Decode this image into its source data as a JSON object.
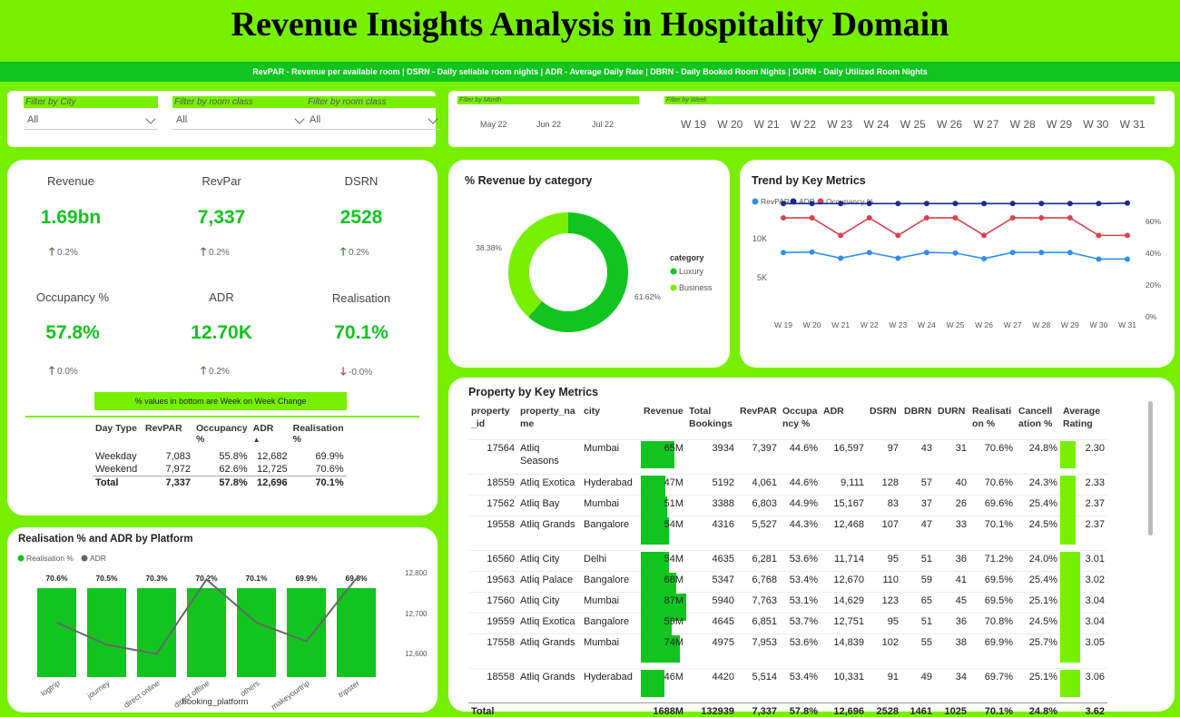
{
  "title": "Revenue Insights Analysis in Hospitality Domain",
  "legend_text": "RevPAR - Revenue per available room | DSRN - Daily sellable room nights | ADR - Average Daily Rate | DBRN - Daily Booked Room Nights | DURN - Daily Utilized Room Nights",
  "filters": [
    {
      "title": "Filter by City",
      "value": "All"
    },
    {
      "title": "Filter by room class",
      "value": "All"
    },
    {
      "title": "Filter by room class",
      "value": "All"
    }
  ],
  "month_filter": {
    "title": "Filter by Month",
    "options": [
      "May 22",
      "Jun 22",
      "Jul 22"
    ]
  },
  "week_filter": {
    "title": "Filter by Week",
    "options": [
      "W 19",
      "W 20",
      "W 21",
      "W 22",
      "W 23",
      "W 24",
      "W 25",
      "W 26",
      "W 27",
      "W 28",
      "W 29",
      "W 30",
      "W 31"
    ]
  },
  "kpis": [
    {
      "label": "Revenue",
      "value": "1.69bn",
      "change": "0.2%",
      "dir": "up"
    },
    {
      "label": "RevPar",
      "value": "7,337",
      "change": "0.2%",
      "dir": "up"
    },
    {
      "label": "DSRN",
      "value": "2528",
      "change": "0.2%",
      "dir": "up"
    },
    {
      "label": "Occupancy %",
      "value": "57.8%",
      "change": "0.0%",
      "dir": "up"
    },
    {
      "label": "ADR",
      "value": "12.70K",
      "change": "0.2%",
      "dir": "up"
    },
    {
      "label": "Realisation",
      "value": "70.1%",
      "change": "-0.0%",
      "dir": "down"
    }
  ],
  "note": "% values in bottom are Week on Week Change",
  "daytype_table": {
    "headers": [
      "Day Type",
      "RevPAR",
      "Occupancy %",
      "ADR",
      "Realisation %"
    ],
    "rows": [
      [
        "Weekday",
        "7,083",
        "55.8%",
        "12,682",
        "69.9%"
      ],
      [
        "Weekend",
        "7,972",
        "62.6%",
        "12,725",
        "70.6%"
      ]
    ],
    "total": [
      "Total",
      "7,337",
      "57.8%",
      "12,696",
      "70.1%"
    ]
  },
  "donut": {
    "title": "% Revenue by category",
    "legend_title": "category",
    "slices": [
      {
        "name": "Luxury",
        "value": 61.62,
        "label": "61.62%",
        "color": "#12c420"
      },
      {
        "name": "Business",
        "value": 38.38,
        "label": "38.38%",
        "color": "#76f000"
      }
    ]
  },
  "trend": {
    "title": "Trend by Key Metrics",
    "legend": [
      {
        "name": "RevPAR",
        "color": "#2f8fe8"
      },
      {
        "name": "ADR",
        "color": "#1a2a8a"
      },
      {
        "name": "Occupancy %",
        "color": "#d9414e"
      }
    ],
    "left_ticks": [
      "10K",
      "5K"
    ],
    "right_ticks": [
      "60%",
      "40%",
      "20%",
      "0%"
    ]
  },
  "platform": {
    "title": "Realisation % and ADR by Platform",
    "legend": [
      {
        "name": "Realisation %",
        "color": "#12c420"
      },
      {
        "name": "ADR",
        "color": "#666666"
      }
    ],
    "xlabel": "booking_platform",
    "right_ticks": [
      "12,800",
      "12,700",
      "12,600"
    ]
  },
  "property_table": {
    "title": "Property by Key Metrics",
    "headers": [
      "property_id",
      "property_name",
      "city",
      "Revenue",
      "Total Bookings",
      "RevPAR",
      "Occupancy %",
      "ADR",
      "DSRN",
      "DBRN",
      "DURN",
      "Realisation %",
      "Cancellation %",
      "Average Rating"
    ],
    "header_lines": [
      [
        "property",
        "_id"
      ],
      [
        "property_na",
        "me"
      ],
      [
        "city",
        ""
      ],
      [
        "Revenue",
        ""
      ],
      [
        "Total",
        "Bookings"
      ],
      [
        "RevPAR",
        ""
      ],
      [
        "Occupa",
        "ncy %"
      ],
      [
        "ADR",
        ""
      ],
      [
        "DSRN",
        ""
      ],
      [
        "DBRN",
        ""
      ],
      [
        "DURN",
        ""
      ],
      [
        "Realisati",
        "on %"
      ],
      [
        "Cancell",
        "ation %"
      ],
      [
        "Average",
        "Rating"
      ]
    ],
    "rows": [
      {
        "id": "17564",
        "name": "Atliq Seasons",
        "city": "Mumbai",
        "revenue": "65M",
        "bookings": "3934",
        "revpar": "7,397",
        "occ": "44.6%",
        "adr": "16,597",
        "dsrn": "97",
        "dbrn": "43",
        "durn": "31",
        "real": "70.6%",
        "canc": "24.8%",
        "rating": "2.30"
      },
      {
        "id": "18559",
        "name": "Atliq Exotica",
        "city": "Hyderabad",
        "revenue": "47M",
        "bookings": "5192",
        "revpar": "4,061",
        "occ": "44.6%",
        "adr": "9,111",
        "dsrn": "128",
        "dbrn": "57",
        "durn": "40",
        "real": "70.6%",
        "canc": "24.3%",
        "rating": "2.33"
      },
      {
        "id": "17562",
        "name": "Atliq Bay",
        "city": "Mumbai",
        "revenue": "51M",
        "bookings": "3388",
        "revpar": "6,803",
        "occ": "44.9%",
        "adr": "15,167",
        "dsrn": "83",
        "dbrn": "37",
        "durn": "26",
        "real": "69.6%",
        "canc": "25.4%",
        "rating": "2.37"
      },
      {
        "id": "19558",
        "name": "Atliq Grands",
        "city": "Bangalore",
        "revenue": "54M",
        "bookings": "4316",
        "revpar": "5,527",
        "occ": "44.3%",
        "adr": "12,468",
        "dsrn": "107",
        "dbrn": "47",
        "durn": "33",
        "real": "70.1%",
        "canc": "24.5%",
        "rating": "2.37"
      },
      {
        "id": "16560",
        "name": "Atliq City",
        "city": "Delhi",
        "revenue": "54M",
        "bookings": "4635",
        "revpar": "6,281",
        "occ": "53.6%",
        "adr": "11,714",
        "dsrn": "95",
        "dbrn": "51",
        "durn": "36",
        "real": "71.2%",
        "canc": "24.0%",
        "rating": "3.01"
      },
      {
        "id": "19563",
        "name": "Atliq Palace",
        "city": "Bangalore",
        "revenue": "68M",
        "bookings": "5347",
        "revpar": "6,768",
        "occ": "53.4%",
        "adr": "12,670",
        "dsrn": "110",
        "dbrn": "59",
        "durn": "41",
        "real": "69.5%",
        "canc": "25.4%",
        "rating": "3.02"
      },
      {
        "id": "17560",
        "name": "Atliq City",
        "city": "Mumbai",
        "revenue": "87M",
        "bookings": "5940",
        "revpar": "7,763",
        "occ": "53.1%",
        "adr": "14,629",
        "dsrn": "123",
        "dbrn": "65",
        "durn": "45",
        "real": "69.5%",
        "canc": "25.1%",
        "rating": "3.04"
      },
      {
        "id": "19559",
        "name": "Atliq Exotica",
        "city": "Bangalore",
        "revenue": "59M",
        "bookings": "4645",
        "revpar": "6,851",
        "occ": "53.7%",
        "adr": "12,751",
        "dsrn": "95",
        "dbrn": "51",
        "durn": "36",
        "real": "70.8%",
        "canc": "24.5%",
        "rating": "3.04"
      },
      {
        "id": "17558",
        "name": "Atliq Grands",
        "city": "Mumbai",
        "revenue": "74M",
        "bookings": "4975",
        "revpar": "7,953",
        "occ": "53.6%",
        "adr": "14,839",
        "dsrn": "102",
        "dbrn": "55",
        "durn": "38",
        "real": "69.9%",
        "canc": "25.7%",
        "rating": "3.05"
      },
      {
        "id": "18558",
        "name": "Atliq Grands",
        "city": "Hyderabad",
        "revenue": "46M",
        "bookings": "4420",
        "revpar": "5,514",
        "occ": "53.4%",
        "adr": "10,331",
        "dsrn": "91",
        "dbrn": "49",
        "durn": "34",
        "real": "69.7%",
        "canc": "25.1%",
        "rating": "3.06"
      }
    ],
    "total": {
      "label": "Total",
      "revenue": "1688M",
      "bookings": "132939",
      "revpar": "7,337",
      "occ": "57.8%",
      "adr": "12,696",
      "dsrn": "2528",
      "dbrn": "1461",
      "durn": "1025",
      "real": "70.1%",
      "canc": "24.8%",
      "rating": "3.62"
    }
  },
  "chart_data": [
    {
      "type": "pie",
      "title": "% Revenue by category",
      "categories": [
        "Luxury",
        "Business"
      ],
      "values": [
        61.62,
        38.38
      ],
      "legend": "category"
    },
    {
      "type": "line",
      "title": "Trend by Key Metrics",
      "x": [
        "W 19",
        "W 20",
        "W 21",
        "W 22",
        "W 23",
        "W 24",
        "W 25",
        "W 26",
        "W 27",
        "W 28",
        "W 29",
        "W 30",
        "W 31"
      ],
      "series": [
        {
          "name": "RevPAR",
          "axis": "left",
          "values": [
            7500,
            7550,
            6900,
            7500,
            6900,
            7500,
            7450,
            6850,
            7500,
            7500,
            7500,
            6800,
            6800
          ]
        },
        {
          "name": "ADR",
          "axis": "left",
          "values": [
            12700,
            12700,
            12700,
            12700,
            12700,
            12700,
            12700,
            12700,
            12700,
            12700,
            12700,
            12700,
            12750
          ]
        },
        {
          "name": "Occupancy %",
          "axis": "right",
          "values": [
            62,
            62,
            51,
            62,
            51,
            62,
            62,
            51,
            62,
            62,
            62,
            51,
            51
          ]
        }
      ],
      "ylim_left": [
        0,
        13500
      ],
      "ylim_right": [
        0,
        70
      ]
    },
    {
      "type": "bar",
      "title": "Realisation % and ADR by Platform",
      "categories": [
        "logtrip",
        "journey",
        "direct online",
        "direct offline",
        "others",
        "makeyourtrip",
        "tripster"
      ],
      "series": [
        {
          "name": "Realisation %",
          "values": [
            70.6,
            70.5,
            70.3,
            70.2,
            70.1,
            69.9,
            69.8
          ],
          "labels": [
            "70.6%",
            "70.5%",
            "70.3%",
            "70.2%",
            "70.1%",
            "69.9%",
            "69.8%"
          ]
        },
        {
          "name": "ADR",
          "values": [
            12700,
            12655,
            12636,
            12788,
            12700,
            12662,
            12790
          ]
        }
      ],
      "xlabel": "booking_platform",
      "adr_range": [
        12580,
        12820
      ]
    }
  ]
}
